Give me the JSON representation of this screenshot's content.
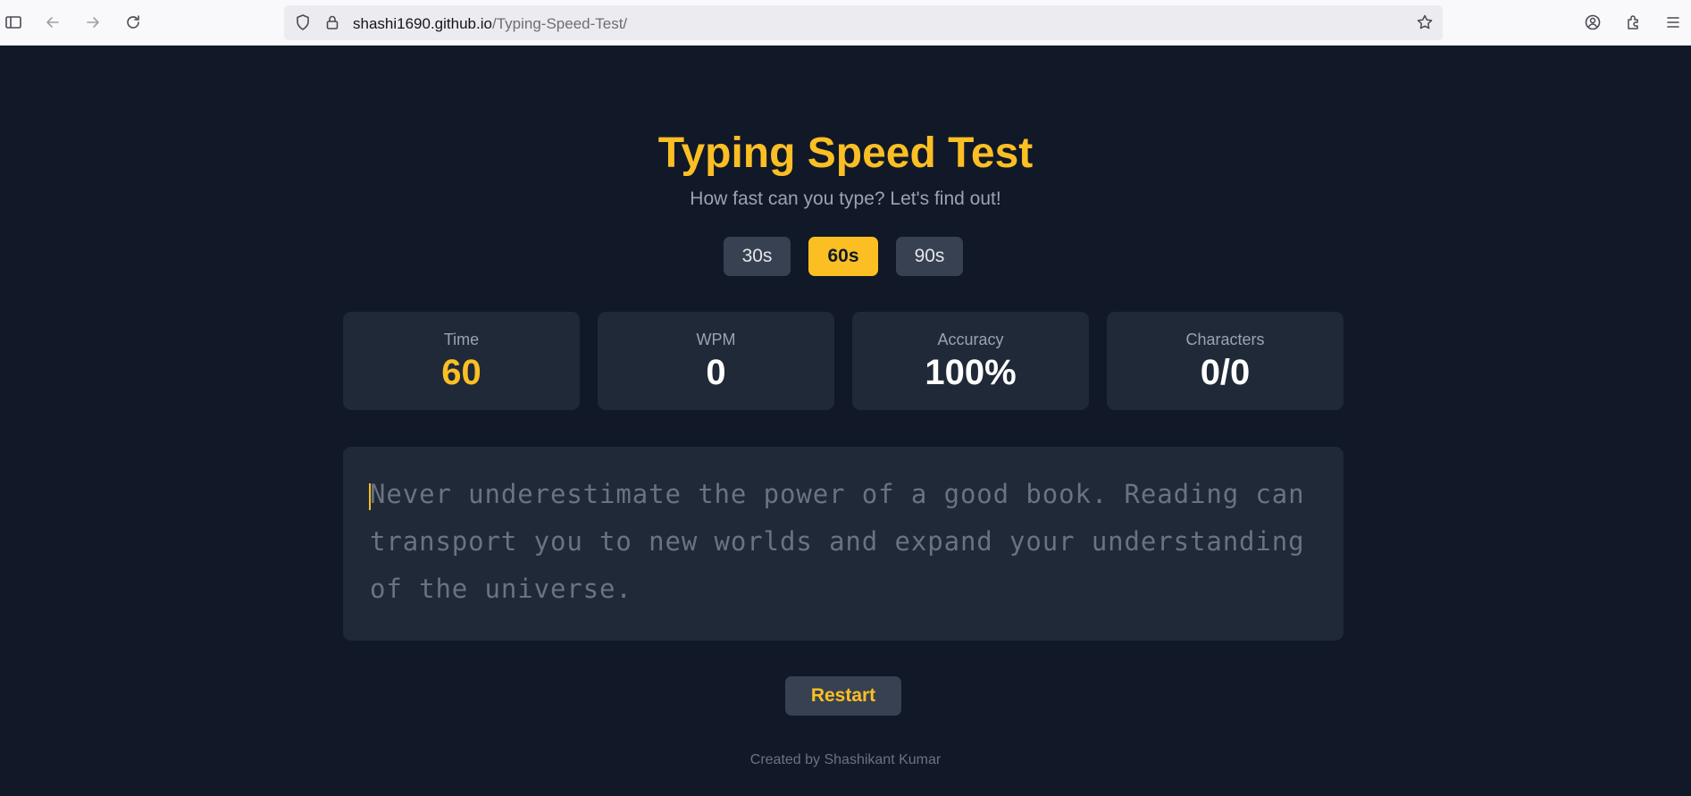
{
  "browser": {
    "url_domain": "shashi1690.github.io",
    "url_path": "/Typing-Speed-Test/"
  },
  "app": {
    "title": "Typing Speed Test",
    "subtitle": "How fast can you type? Let's find out!",
    "durations": [
      {
        "label": "30s",
        "active": false
      },
      {
        "label": "60s",
        "active": true
      },
      {
        "label": "90s",
        "active": false
      }
    ],
    "stats": [
      {
        "label": "Time",
        "value": "60"
      },
      {
        "label": "WPM",
        "value": "0"
      },
      {
        "label": "Accuracy",
        "value": "100%"
      },
      {
        "label": "Characters",
        "value": "0/0"
      }
    ],
    "text": "Never underestimate the power of a good book. Reading can transport you to new worlds and expand your understanding of the universe.",
    "restart_label": "Restart",
    "footer": "Created by Shashikant Kumar"
  },
  "colors": {
    "background": "#111827",
    "card": "#1f2937",
    "accent": "#fbbf24",
    "button": "#374151",
    "muted_text": "#9ca3af"
  },
  "icons": [
    "sidebar-icon",
    "back-icon",
    "forward-icon",
    "reload-icon",
    "shield-icon",
    "lock-icon",
    "bookmark-star-icon",
    "account-icon",
    "extensions-icon",
    "menu-icon"
  ]
}
